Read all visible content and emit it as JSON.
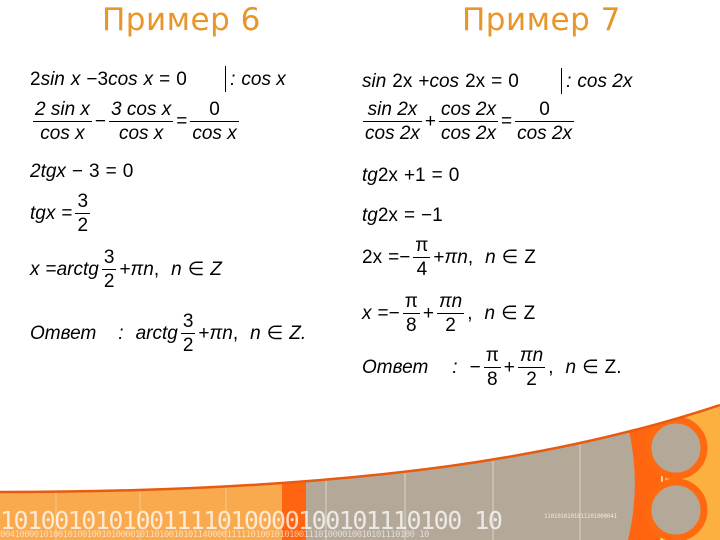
{
  "titles": {
    "example6": "Пример 6",
    "example7": "Пример 7"
  },
  "example6": {
    "line1": {
      "lhs_a": "2",
      "sin": "sin",
      "x1": "x",
      "minus": "−",
      "coef": "3",
      "cos": "cos",
      "x2": "x",
      "eq": "=",
      "rhs": "0",
      "divider": ":",
      "divisor": "cos x"
    },
    "line2": {
      "n1": "2 sin x",
      "d1": "cos x",
      "op1": "−",
      "n2": "3 cos x",
      "d2": "cos x",
      "eq": "=",
      "n3": "0",
      "d3": "cos x"
    },
    "line3": {
      "lhs": "2tgx",
      "minus": "−",
      "c": "3",
      "eq": "=",
      "rhs": "0"
    },
    "line4": {
      "lhs": "tgx",
      "eq": "=",
      "num": "3",
      "den": "2"
    },
    "line5": {
      "x": "x",
      "eq": "=",
      "fn": "arctg",
      "num": "3",
      "den": "2",
      "plus": "+",
      "pin": "πn",
      "comma": ",",
      "n": "n",
      "in": "∈",
      "set": "Z"
    },
    "answer": {
      "label": "Ответ",
      "colon": ":",
      "fn": "arctg",
      "num": "3",
      "den": "2",
      "plus": "+",
      "pin": "πn",
      "comma": ",",
      "n": "n",
      "in": "∈",
      "set": "Z."
    }
  },
  "example7": {
    "line1": {
      "sin": "sin",
      "arg1": "2x",
      "plus": "+",
      "cos": "cos",
      "arg2": "2x",
      "eq": "=",
      "rhs": "0",
      "divider": ":",
      "divisor": "cos 2x"
    },
    "line2": {
      "n1": "sin 2x",
      "d1": "cos 2x",
      "op1": "+",
      "n2": "cos 2x",
      "d2": "cos 2x",
      "eq": "=",
      "n3": "0",
      "d3": "cos 2x"
    },
    "line3": {
      "lhs": "tg",
      "arg": "2x",
      "plus": "+",
      "c": "1",
      "eq": "=",
      "rhs": "0"
    },
    "line4": {
      "lhs": "tg",
      "arg": "2x",
      "eq": "=",
      "rhs": "−1"
    },
    "line5": {
      "lhs": "2x",
      "eq": "=",
      "minus": "−",
      "num": "π",
      "den": "4",
      "plus": "+",
      "pin": "πn",
      "comma": ",",
      "n": "n",
      "in": "∈",
      "set": "Z"
    },
    "line6": {
      "x": "x",
      "eq": "=",
      "minus": "−",
      "num1": "π",
      "den1": "8",
      "plus": "+",
      "num2": "πn",
      "den2": "2",
      "comma": ",",
      "n": "n",
      "in": "∈",
      "set": "Z"
    },
    "answer": {
      "label": "Ответ",
      "colon": ":",
      "minus": "−",
      "num1": "π",
      "den1": "8",
      "plus": "+",
      "num2": "πn",
      "den2": "2",
      "comma": ",",
      "n": "n",
      "in": "∈",
      "set": "Z."
    }
  },
  "decoration": {
    "binary_large": "1010010101001111010000100101110100 10",
    "binary_small": "00410000101001010010010100001011010010101140000111110100101010011101000010010101110100 10",
    "binary_tiny": "1101010101011101000041",
    "colors": {
      "orange": "#ff6a10",
      "light_orange": "#f9a94e",
      "gray": "#b4a898",
      "yellow": "#fbb040",
      "title": "#e8962a"
    }
  }
}
